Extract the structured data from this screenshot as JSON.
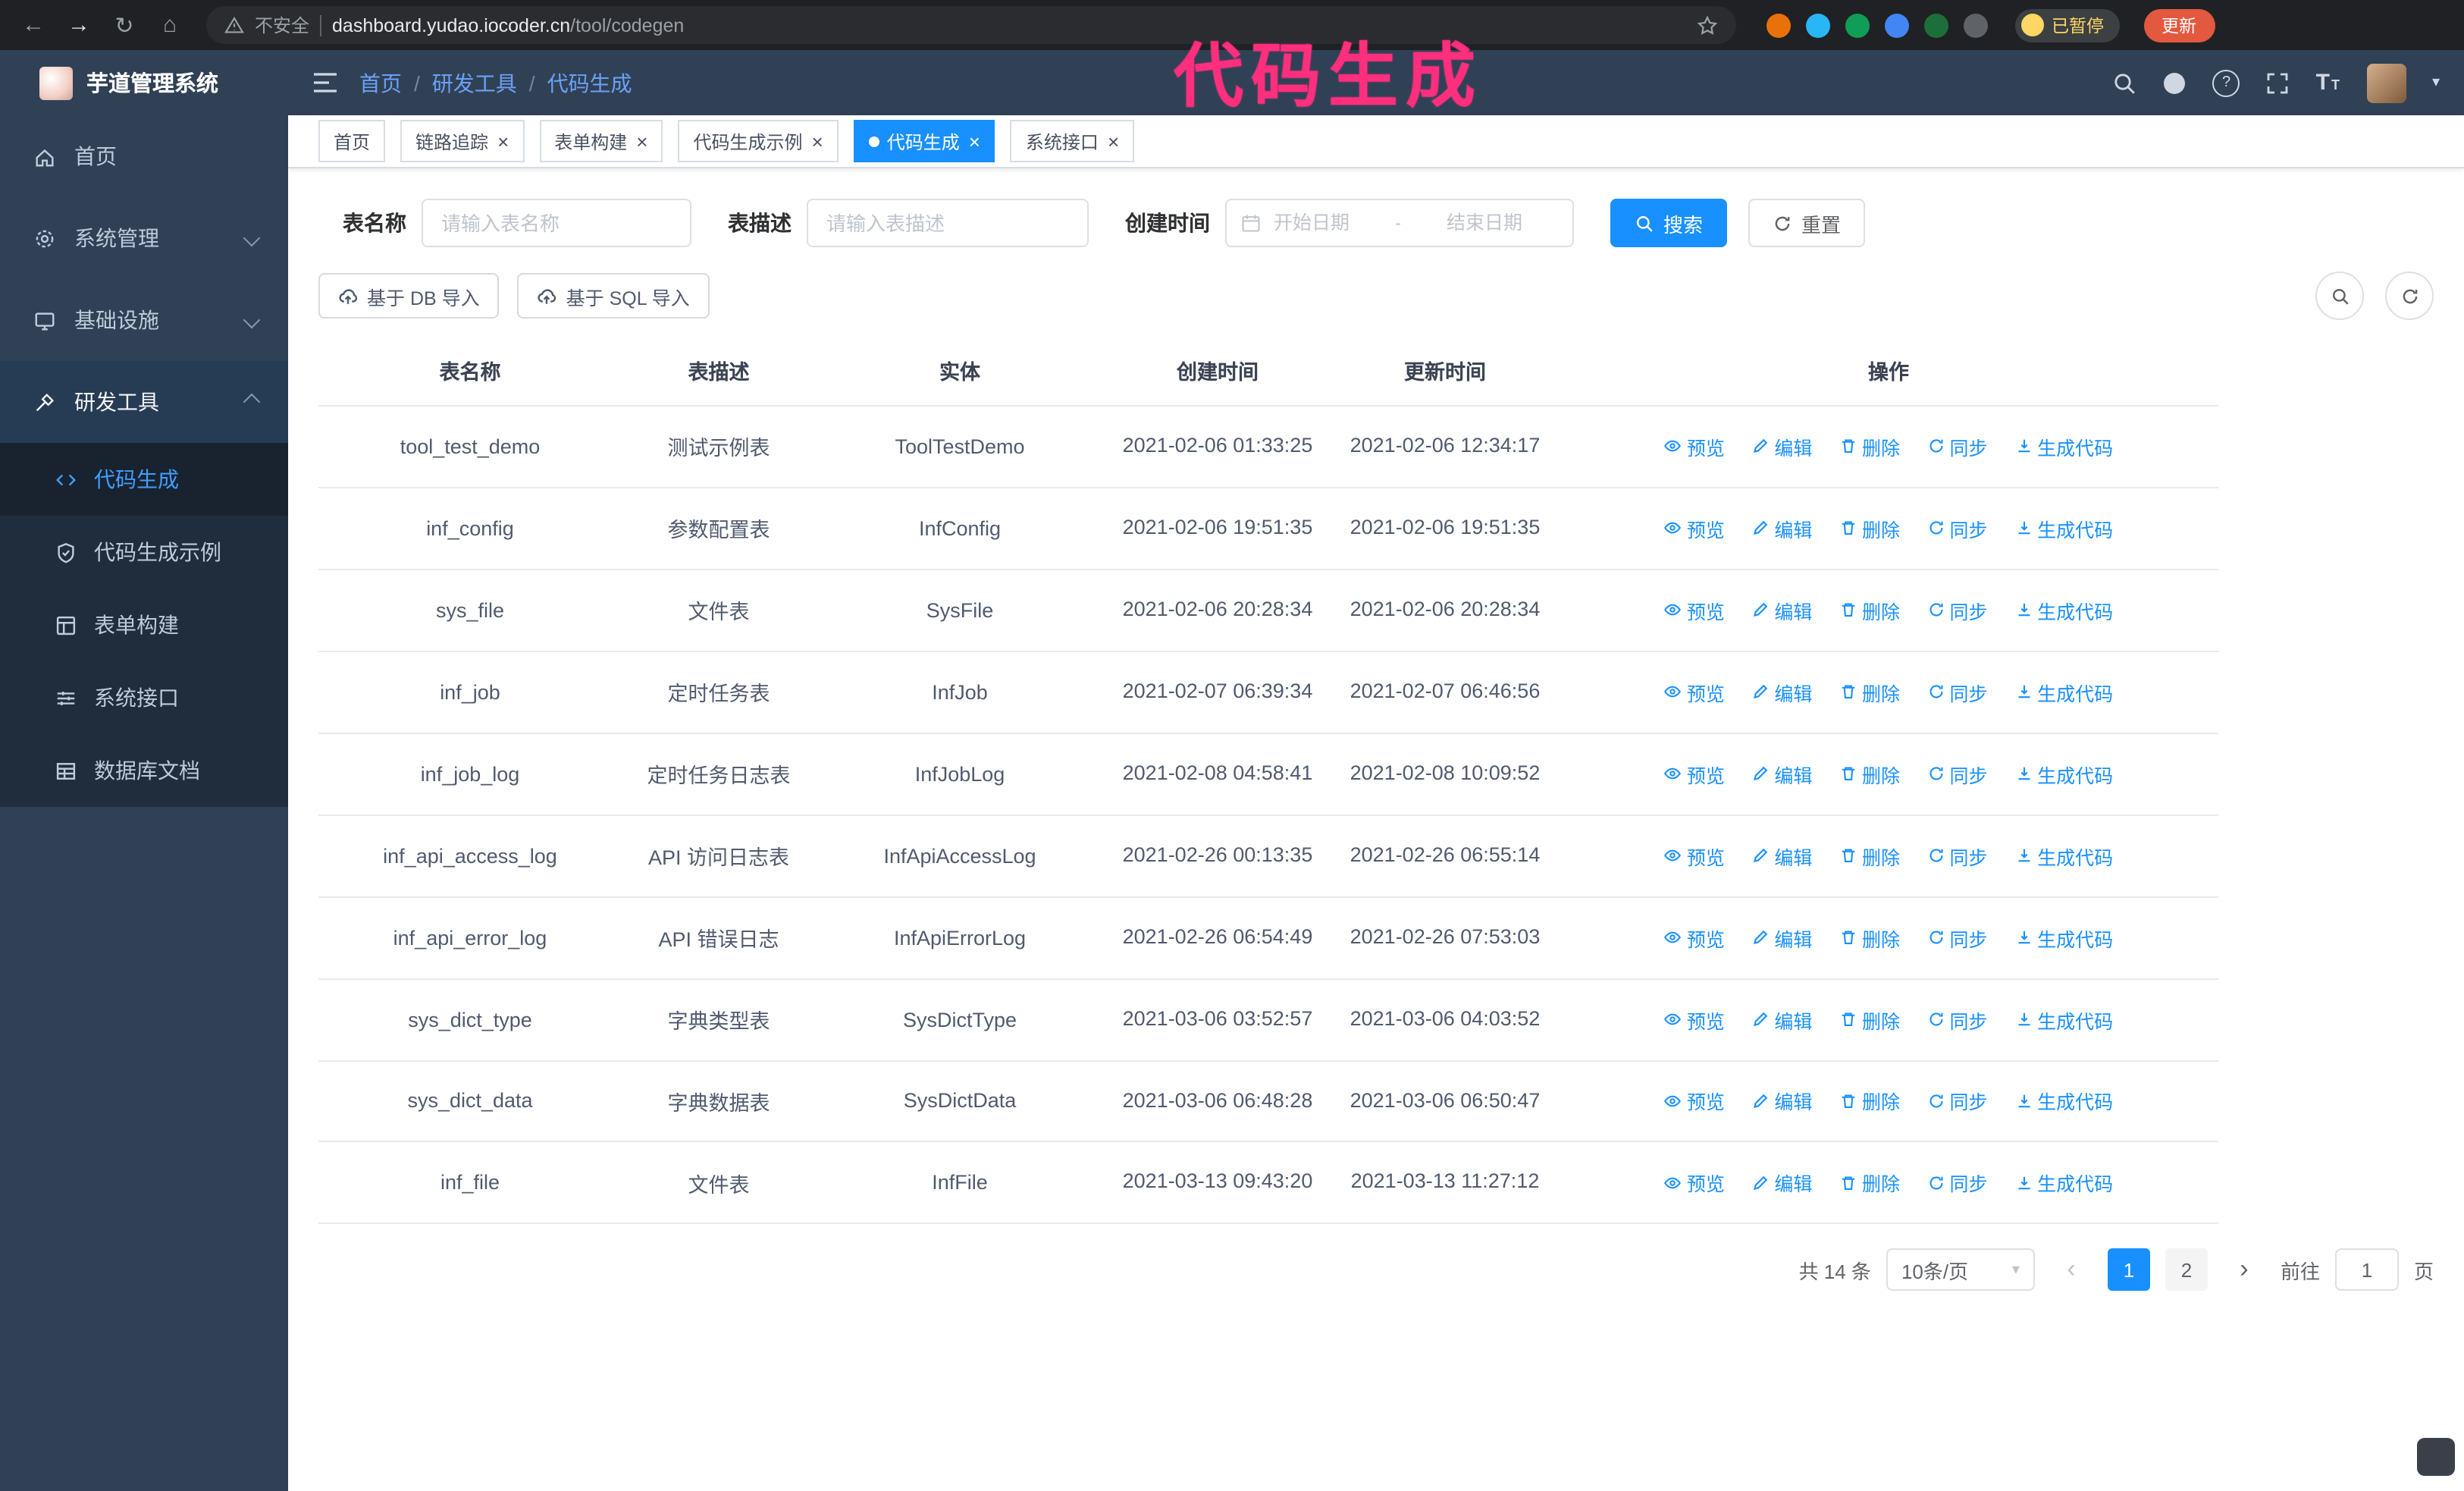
{
  "colors": {
    "accent": "#1890ff",
    "sidebar_bg": "#304156",
    "submenu_bg": "#1f2d3d",
    "chrome_bg": "#202124",
    "overlay_pink": "#ff2f7e",
    "update_button_bg": "#e2593f",
    "paused_text": "#fdd663",
    "active_menu_text": "#409eff"
  },
  "icons": {
    "back-icon": "←",
    "forward-icon": "→",
    "reload-icon": "↻",
    "home-icon": "⌂",
    "warning-icon": "triangle-exclaim",
    "star-icon": "☆",
    "hamburger-icon": "three-lines",
    "search-icon": "magnifier",
    "github-icon": "filled-circle",
    "help-icon": "?",
    "fullscreen-icon": "corner-brackets",
    "font-size-icon": "T",
    "caret-down-icon": "▾",
    "calendar-icon": "calendar",
    "upload-icon": "cloud-arrow-up",
    "refresh-icon": "circular-arrows",
    "eye-icon": "eye",
    "edit-icon": "pencil",
    "delete-icon": "trash",
    "sync-icon": "circular-arrows",
    "generate-code-icon": "download-arrow",
    "active-tab-dot": "white-dot"
  },
  "browser": {
    "security_warning": "不安全",
    "url_domain": "dashboard.yudao.iocoder.cn",
    "url_path": "/tool/codegen",
    "paused_badge": "已暂停",
    "update_button": "更新"
  },
  "overlay": {
    "text": "代码生成"
  },
  "header": {
    "logo_title": "芋道管理系统",
    "breadcrumb": [
      "首页",
      "研发工具",
      "代码生成"
    ]
  },
  "sidebar": {
    "items": [
      {
        "label": "首页"
      },
      {
        "label": "系统管理"
      },
      {
        "label": "基础设施"
      },
      {
        "label": "研发工具"
      }
    ],
    "submenu": [
      {
        "label": "代码生成",
        "active": true
      },
      {
        "label": "代码生成示例"
      },
      {
        "label": "表单构建"
      },
      {
        "label": "系统接口"
      },
      {
        "label": "数据库文档"
      }
    ]
  },
  "tabs": [
    {
      "label": "首页",
      "closable": false,
      "active": false
    },
    {
      "label": "链路追踪",
      "closable": true,
      "active": false
    },
    {
      "label": "表单构建",
      "closable": true,
      "active": false
    },
    {
      "label": "代码生成示例",
      "closable": true,
      "active": false
    },
    {
      "label": "代码生成",
      "closable": true,
      "active": true
    },
    {
      "label": "系统接口",
      "closable": true,
      "active": false
    }
  ],
  "filters": {
    "table_name_label": "表名称",
    "table_name_placeholder": "请输入表名称",
    "table_desc_label": "表描述",
    "table_desc_placeholder": "请输入表描述",
    "create_time_label": "创建时间",
    "date_start_placeholder": "开始日期",
    "date_separator": "-",
    "date_end_placeholder": "结束日期",
    "search_button": "搜索",
    "reset_button": "重置"
  },
  "toolbar": {
    "import_db_button": "基于 DB 导入",
    "import_sql_button": "基于 SQL 导入"
  },
  "table": {
    "columns": [
      "表名称",
      "表描述",
      "实体",
      "创建时间",
      "更新时间",
      "操作"
    ],
    "actions": [
      "预览",
      "编辑",
      "删除",
      "同步",
      "生成代码"
    ],
    "rows": [
      {
        "name": "tool_test_demo",
        "desc": "测试示例表",
        "entity": "ToolTestDemo",
        "created": "2021-02-06 01:33:25",
        "updated": "2021-02-06 12:34:17"
      },
      {
        "name": "inf_config",
        "desc": "参数配置表",
        "entity": "InfConfig",
        "created": "2021-02-06 19:51:35",
        "updated": "2021-02-06 19:51:35"
      },
      {
        "name": "sys_file",
        "desc": "文件表",
        "entity": "SysFile",
        "created": "2021-02-06 20:28:34",
        "updated": "2021-02-06 20:28:34"
      },
      {
        "name": "inf_job",
        "desc": "定时任务表",
        "entity": "InfJob",
        "created": "2021-02-07 06:39:34",
        "updated": "2021-02-07 06:46:56"
      },
      {
        "name": "inf_job_log",
        "desc": "定时任务日志表",
        "entity": "InfJobLog",
        "created": "2021-02-08 04:58:41",
        "updated": "2021-02-08 10:09:52"
      },
      {
        "name": "inf_api_access_log",
        "desc": "API 访问日志表",
        "entity": "InfApiAccessLog",
        "created": "2021-02-26 00:13:35",
        "updated": "2021-02-26 06:55:14"
      },
      {
        "name": "inf_api_error_log",
        "desc": "API 错误日志",
        "entity": "InfApiErrorLog",
        "created": "2021-02-26 06:54:49",
        "updated": "2021-02-26 07:53:03"
      },
      {
        "name": "sys_dict_type",
        "desc": "字典类型表",
        "entity": "SysDictType",
        "created": "2021-03-06 03:52:57",
        "updated": "2021-03-06 04:03:52"
      },
      {
        "name": "sys_dict_data",
        "desc": "字典数据表",
        "entity": "SysDictData",
        "created": "2021-03-06 06:48:28",
        "updated": "2021-03-06 06:50:47"
      },
      {
        "name": "inf_file",
        "desc": "文件表",
        "entity": "InfFile",
        "created": "2021-03-13 09:43:20",
        "updated": "2021-03-13 11:27:12"
      }
    ]
  },
  "pagination": {
    "total": "共 14 条",
    "page_size": "10条/页",
    "pages": [
      "1",
      "2"
    ],
    "goto_label": "前往",
    "goto_value": "1",
    "page_suffix": "页"
  }
}
